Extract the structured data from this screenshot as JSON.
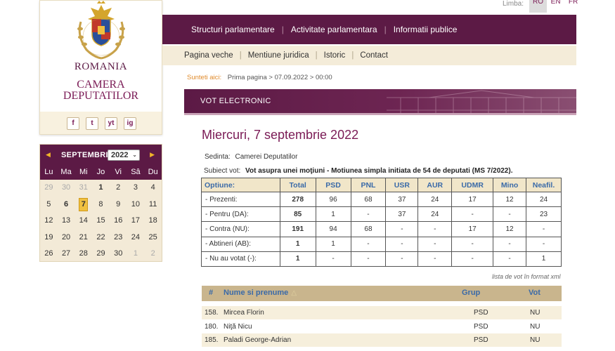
{
  "left": {
    "country": "ROMANIA",
    "institution_line1": "CAMERA",
    "institution_line2": "DEPUTATILOR",
    "crest_text": "CAMERA DEPUTAȚILOR",
    "social": [
      "f",
      "t",
      "yt",
      "ig"
    ]
  },
  "calendar": {
    "month": "SEPTEMBRIE",
    "year": "2022",
    "weekdays": [
      "Lu",
      "Ma",
      "Mi",
      "Jo",
      "Vi",
      "Sâ",
      "Du"
    ],
    "rows": [
      [
        "29",
        "30",
        "31",
        "1",
        "2",
        "3",
        "4"
      ],
      [
        "5",
        "6",
        "7",
        "8",
        "9",
        "10",
        "11"
      ],
      [
        "12",
        "13",
        "14",
        "15",
        "16",
        "17",
        "18"
      ],
      [
        "19",
        "20",
        "21",
        "22",
        "23",
        "24",
        "25"
      ],
      [
        "26",
        "27",
        "28",
        "29",
        "30",
        "1",
        "2"
      ]
    ],
    "selected": "7"
  },
  "lang": {
    "label": "Limba:",
    "options": [
      "RO",
      "EN",
      "FR"
    ],
    "active": "RO"
  },
  "main_nav": [
    "Structuri parlamentare",
    "Activitate parlamentara",
    "Informatii publice"
  ],
  "sub_nav": [
    "Pagina veche",
    "Mentiune juridica",
    "Istoric",
    "Contact"
  ],
  "breadcrumb": {
    "here": "Sunteti aici:",
    "path": "Prima pagina > 07.09.2022 > 00:00"
  },
  "banner": {
    "title": "VOT ELECTRONIC"
  },
  "page_title": "Miercuri, 7 septembrie 2022",
  "meta": {
    "sedinta_label": "Sedinta:",
    "sedinta_value": "Camerei Deputatilor",
    "subiect_label": "Subiect vot:",
    "subiect_value": "Vot asupra unei moţiuni - Motiunea simpla initiata de 54 de deputati (MS 7/2022)."
  },
  "vote_table": {
    "headers": [
      "Optiune:",
      "Total",
      "PSD",
      "PNL",
      "USR",
      "AUR",
      "UDMR",
      "Mino",
      "Neafil."
    ],
    "rows": [
      [
        "- Prezenti:",
        "278",
        "96",
        "68",
        "37",
        "24",
        "17",
        "12",
        "24"
      ],
      [
        "- Pentru (DA):",
        "85",
        "1",
        "-",
        "37",
        "24",
        "-",
        "-",
        "23"
      ],
      [
        "- Contra (NU):",
        "191",
        "94",
        "68",
        "-",
        "-",
        "17",
        "12",
        "-"
      ],
      [
        "- Abtineri (AB):",
        "1",
        "1",
        "-",
        "-",
        "-",
        "-",
        "-",
        "-"
      ],
      [
        "- Nu au votat (-):",
        "1",
        "-",
        "-",
        "-",
        "-",
        "-",
        "-",
        "1"
      ]
    ]
  },
  "xml_link": "lista de vot în format xml",
  "deputy_list": {
    "headers": [
      "#",
      "Nume si prenume",
      "Grup",
      "Vot"
    ],
    "rows": [
      [
        "158.",
        "Mircea Florin",
        "PSD",
        "NU"
      ],
      [
        "180.",
        "Niţă Nicu",
        "PSD",
        "NU"
      ],
      [
        "185.",
        "Paladi George-Adrian",
        "PSD",
        "NU"
      ]
    ]
  }
}
